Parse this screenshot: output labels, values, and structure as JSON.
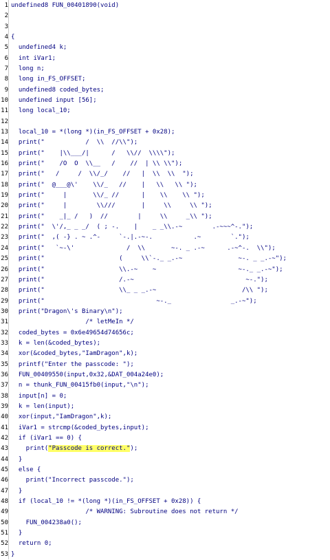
{
  "editor": {
    "lines": [
      "undefined8 FUN_00401890(void)",
      "",
      "",
      "{",
      "  undefined4 k;",
      "  int iVar1;",
      "  long n;",
      "  long in_FS_OFFSET;",
      "  undefined8 coded_bytes;",
      "  undefined input [56];",
      "  long local_10;",
      "",
      "  local_10 = *(long *)(in_FS_OFFSET + 0x28);",
      "  print(\"           /  \\\\  //\\\\\");",
      "  print(\"    |\\\\___/|      /   \\\\//  \\\\\\\\\");",
      "  print(\"    /O  O  \\\\__   /    //  | \\\\ \\\\\");",
      "  print(\"   /     /  \\\\/_/    //   |  \\\\  \\\\  \");",
      "  print(\"  @___@\\'    \\\\/_   //    |   \\\\   \\\\ \");",
      "  print(\"     |       \\\\/_ //      |    \\\\    \\\\ \");",
      "  print(\"     |        \\\\///       |     \\\\     \\\\ \");",
      "  print(\"    _|_ /   )  //        |     \\\\     _\\\\ \");",
      "  print(\"  \\'/,_ _ _/  ( ; -.    |    _ _\\\\.-~        .-~~~^-.\");",
      "  print(\"  ,( -} . ~ .^-     `-.|.-~-.           .~        `.\");",
      "  print(\"   `~-\\'              /  \\\\       ~-. _ .-~      .-~^-.  \\\\\");",
      "  print(\"                    (     \\\\`-._ _.-~               ~-. _ _.-~\");",
      "  print(\"                    \\\\.-~    ~                      ~-._ _.-~\");",
      "  print(\"                    /.-~                              ~-.\");",
      "  print(\"                    \\\\_ _ _.-~                       /\\\\ \");",
      "  print(\"                              ~-._                _.-~\");",
      "  print(\"Dragon\\'s Binary\\n\");",
      "                    /* letMeIn */",
      "  coded_bytes = 0x6e49654d74656c;",
      "  k = len(&coded_bytes);",
      "  xor(&coded_bytes,\"IamDragon\",k);",
      "  printf(\"Enter the passcode: \");",
      "  FUN_00409550(input,0x32,&DAT_004a24e0);",
      "  n = thunk_FUN_00415fb0(input,\"\\n\");",
      "  input[n] = 0;",
      "  k = len(input);",
      "  xor(input,\"IamDragon\",k);",
      "  iVar1 = strcmp(&coded_bytes,input);",
      "  if (iVar1 == 0) {",
      "    print(\"Passcode is correct.\");",
      "  }",
      "  else {",
      "    print(\"Incorrect passcode.\");",
      "  }",
      "  if (local_10 != *(long *)(in_FS_OFFSET + 0x28)) {",
      "                    /* WARNING: Subroutine does not return */",
      "    FUN_004238a0();",
      "  }",
      "  return 0;",
      "}"
    ],
    "highlight": {
      "line": 43,
      "text": "\"Passcode is correct.\""
    }
  }
}
